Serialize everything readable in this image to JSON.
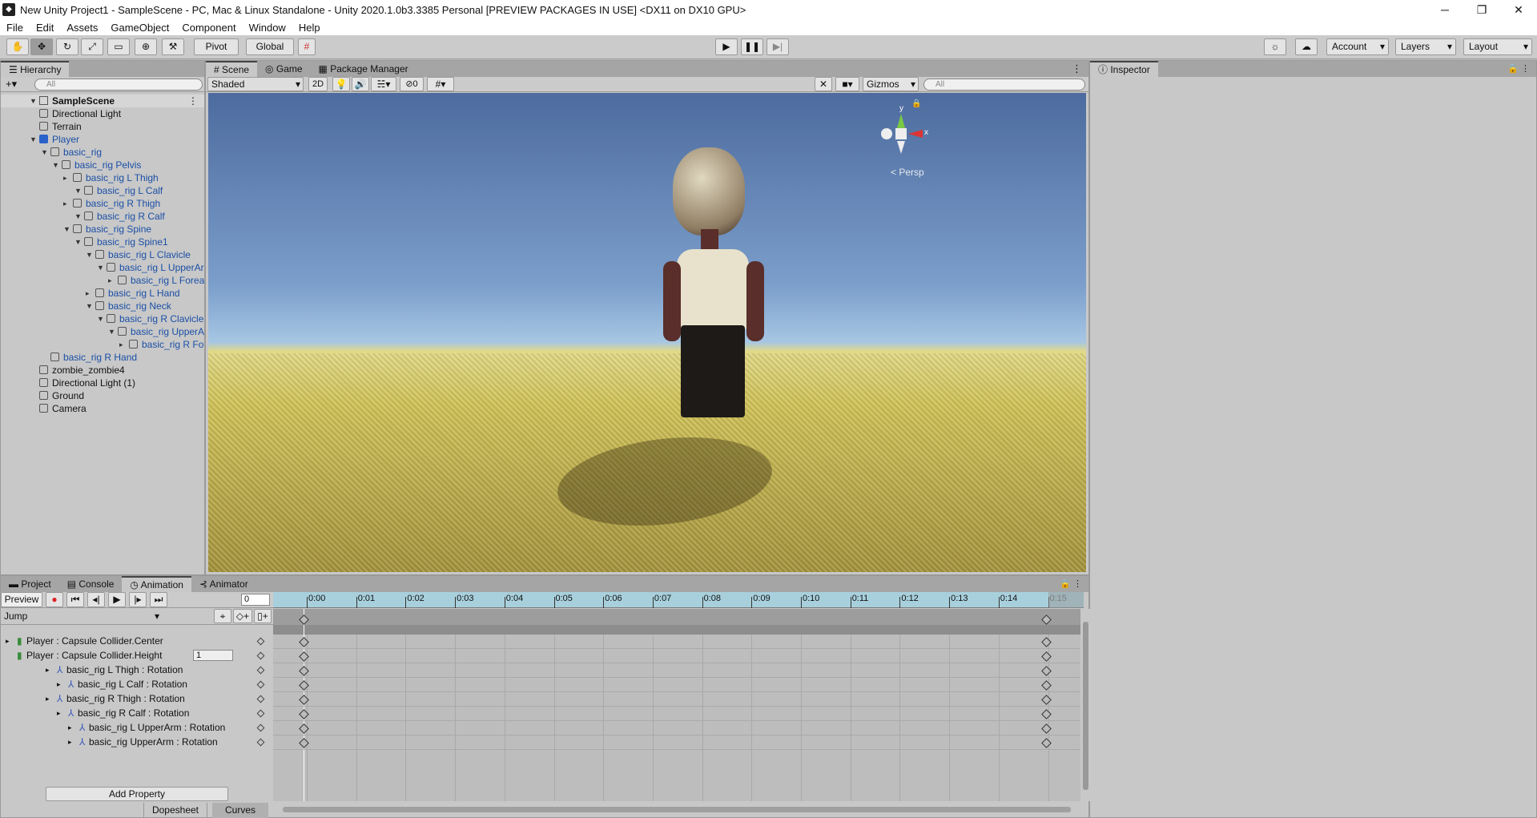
{
  "window": {
    "title": "New Unity Project1 - SampleScene - PC, Mac & Linux Standalone - Unity 2020.1.0b3.3385 Personal [PREVIEW PACKAGES IN USE] <DX11 on DX10 GPU>",
    "min": "─",
    "max": "❐",
    "close": "✕"
  },
  "menu": [
    "File",
    "Edit",
    "Assets",
    "GameObject",
    "Component",
    "Window",
    "Help"
  ],
  "toolbar": {
    "pivot": "Pivot",
    "global": "Global",
    "account": "Account",
    "layers": "Layers",
    "layout": "Layout"
  },
  "hierarchy": {
    "tab": "Hierarchy",
    "search": "All",
    "scene": "SampleScene",
    "items": [
      "Directional Light",
      "Terrain",
      "Player",
      "basic_rig",
      "basic_rig Pelvis",
      "basic_rig L Thigh",
      "basic_rig L Calf",
      "basic_rig R Thigh",
      "basic_rig R Calf",
      "basic_rig Spine",
      "basic_rig Spine1",
      "basic_rig L Clavicle",
      "basic_rig L UpperArm",
      "basic_rig L Forearm",
      "basic_rig L Hand",
      "basic_rig Neck",
      "basic_rig R Clavicle",
      "basic_rig UpperArm",
      "basic_rig R Forearm",
      "basic_rig R Hand",
      "zombie_zombie4",
      "Directional Light (1)",
      "Ground",
      "Camera"
    ]
  },
  "scene": {
    "tabs": [
      "Scene",
      "Game",
      "Package Manager"
    ],
    "shading": "Shaded",
    "mode2d": "2D",
    "hidden_count": "0",
    "gizmos": "Gizmos",
    "search": "All",
    "persp": "Persp",
    "axis_y": "y",
    "axis_x": "x"
  },
  "inspector": {
    "tab": "Inspector"
  },
  "bottom": {
    "tabs": [
      "Project",
      "Console",
      "Animation",
      "Animator"
    ],
    "preview": "Preview",
    "frame": "0",
    "clip": "Jump",
    "timeline": [
      "0:00",
      "0:01",
      "0:02",
      "0:03",
      "0:04",
      "0:05",
      "0:06",
      "0:07",
      "0:08",
      "0:09",
      "0:10",
      "0:11",
      "0:12",
      "0:13",
      "0:14",
      "0:15"
    ],
    "properties": [
      {
        "label": "Player : Capsule Collider.Center",
        "value": ""
      },
      {
        "label": "Player : Capsule Collider.Height",
        "value": "1"
      },
      {
        "label": "basic_rig L Thigh : Rotation",
        "value": ""
      },
      {
        "label": "basic_rig L Calf : Rotation",
        "value": ""
      },
      {
        "label": "basic_rig R Thigh : Rotation",
        "value": ""
      },
      {
        "label": "basic_rig R Calf : Rotation",
        "value": ""
      },
      {
        "label": "basic_rig L UpperArm : Rotation",
        "value": ""
      },
      {
        "label": "basic_rig UpperArm : Rotation",
        "value": ""
      }
    ],
    "add_property": "Add Property",
    "dopesheet": "Dopesheet",
    "curves": "Curves"
  },
  "colors": {
    "sky_top": "#4a6a9e",
    "ground": "#c9b84c",
    "timeline": "#a8d0dc"
  }
}
